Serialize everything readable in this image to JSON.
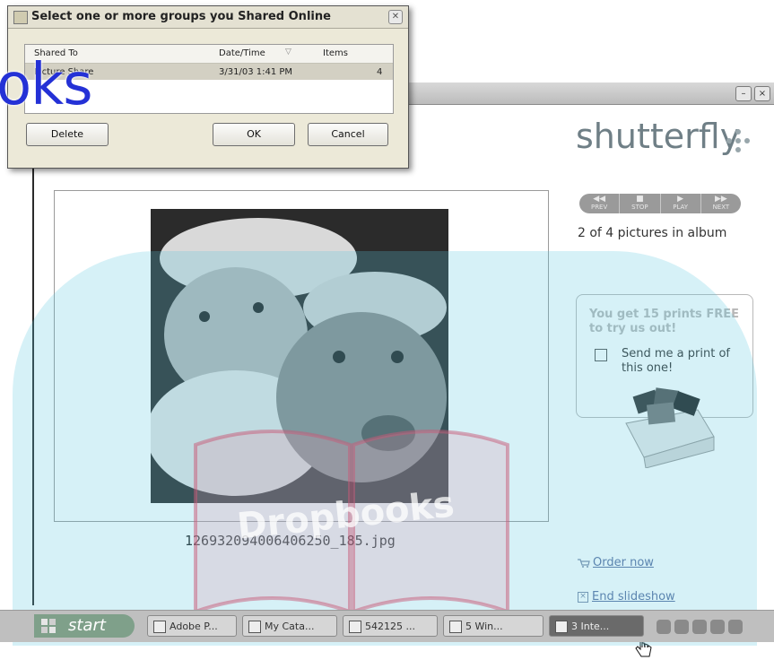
{
  "dialog": {
    "title": "Select one or more groups you Shared Online",
    "columns": {
      "shared_to": "Shared To",
      "date_time": "Date/Time",
      "items": "Items"
    },
    "rows": [
      {
        "shared_to": "Picture Share",
        "date_time": "3/31/03 1:41 PM",
        "items": "4"
      }
    ],
    "buttons": {
      "delete": "Delete",
      "ok": "OK",
      "cancel": "Cancel"
    }
  },
  "watermark": {
    "text": "oks"
  },
  "window": {
    "logo": "shutterfly",
    "controls": {
      "prev": "PREV",
      "stop": "STOP",
      "play": "PLAY",
      "next": "NEXT"
    },
    "album_status": "2 of 4 pictures in album",
    "promo": {
      "headline": "You get 15 prints FREE to try us out!",
      "checkbox_label": "Send me a print of this one!"
    },
    "photo_filename": "126932094006406250_185.jpg",
    "order_link": "Order now",
    "end_link": "End slideshow"
  },
  "overlay": {
    "text": "Dropbooks"
  },
  "taskbar": {
    "start": "start",
    "tasks": [
      "Adobe P...",
      "My Cata...",
      "542125 ...",
      "5 Win...",
      "3 Inte..."
    ]
  },
  "colors": {
    "dialog_bg": "#ece9d8",
    "watermark_blue": "#2431d6",
    "overlay_cyan": "#5ac8e1",
    "link": "#5b6fa0"
  }
}
